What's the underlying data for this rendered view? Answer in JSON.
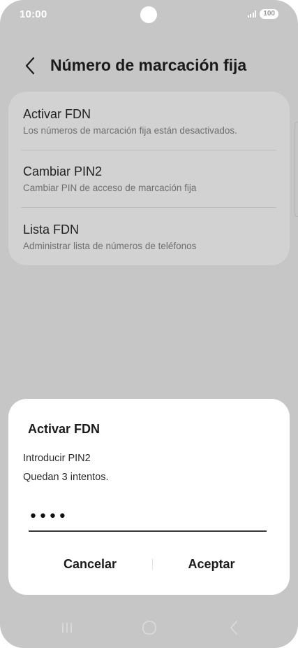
{
  "status": {
    "time": "10:00",
    "battery": "100"
  },
  "header": {
    "title": "Número de marcación fija"
  },
  "settings": {
    "items": [
      {
        "title": "Activar FDN",
        "subtitle": "Los números de marcación fija están desactivados."
      },
      {
        "title": "Cambiar PIN2",
        "subtitle": "Cambiar PIN de acceso de marcación fija"
      },
      {
        "title": "Lista FDN",
        "subtitle": "Administrar lista de números de teléfonos"
      }
    ]
  },
  "dialog": {
    "title": "Activar FDN",
    "line1": "Introducir PIN2",
    "line2": "Quedan 3 intentos.",
    "pin_value": "••••",
    "cancel_label": "Cancelar",
    "accept_label": "Aceptar"
  },
  "icons": {
    "back": "chevron-left-icon",
    "nav_recents": "recents-icon",
    "nav_home": "home-icon",
    "nav_back": "back-icon"
  },
  "colors": {
    "scrim": "#c6c6c6",
    "card": "#d2d2d2",
    "dialog": "#ffffff"
  }
}
